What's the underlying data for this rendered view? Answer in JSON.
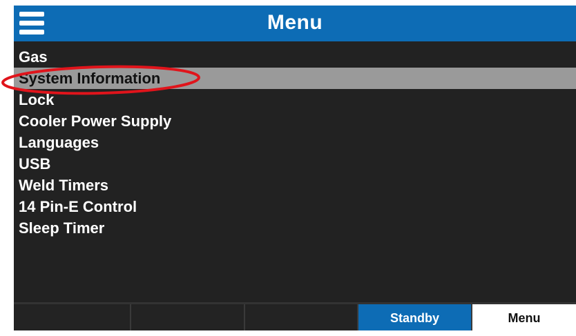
{
  "header": {
    "title": "Menu",
    "menu_icon": "hamburger-menu-icon"
  },
  "menu": {
    "items": [
      {
        "label": "Gas"
      },
      {
        "label": "System Information",
        "selected": true
      },
      {
        "label": "Lock"
      },
      {
        "label": "Cooler Power Supply"
      },
      {
        "label": "Languages"
      },
      {
        "label": "USB"
      },
      {
        "label": "Weld Timers"
      },
      {
        "label": "14 Pin-E Control"
      },
      {
        "label": "Sleep Timer"
      }
    ]
  },
  "footer": {
    "buttons": [
      {
        "label": ""
      },
      {
        "label": ""
      },
      {
        "label": ""
      },
      {
        "label": "Standby"
      },
      {
        "label": "Menu"
      }
    ]
  },
  "colors": {
    "header_bg": "#0d6cb5",
    "screen_bg": "#222222",
    "selected_row_bg": "#9a9a9a",
    "annotation_ring": "#e0141b"
  }
}
